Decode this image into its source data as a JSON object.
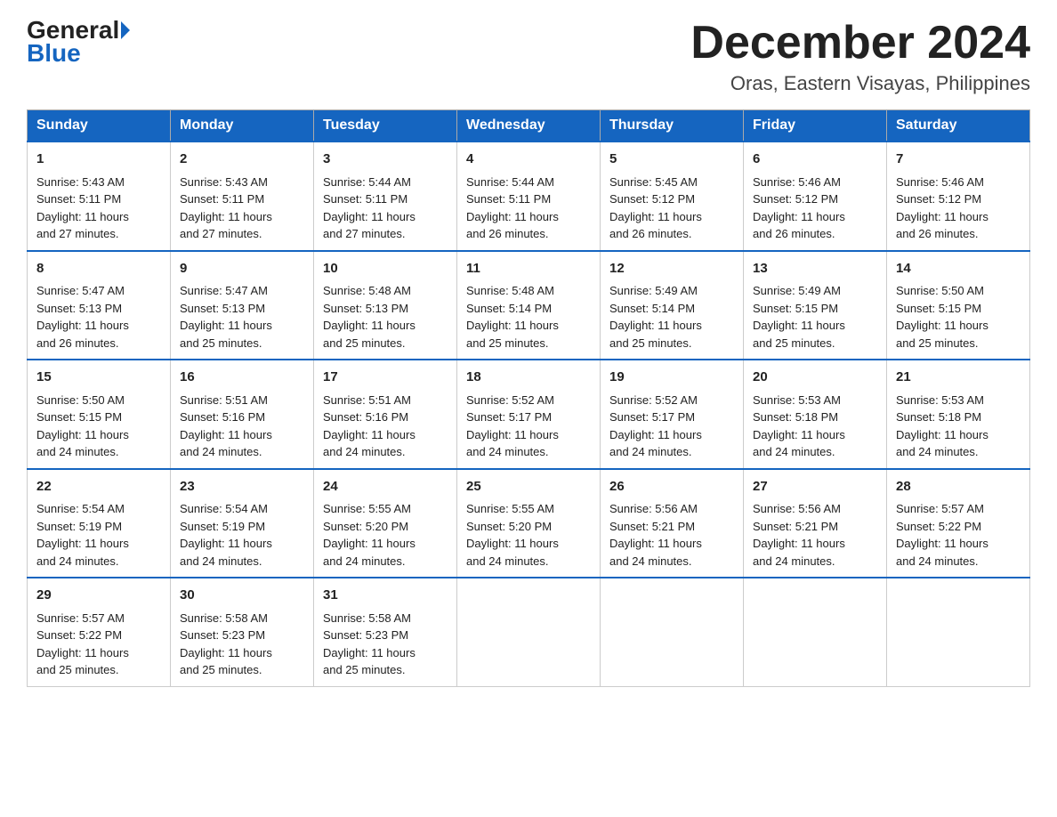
{
  "header": {
    "logo_general": "General",
    "logo_blue": "Blue",
    "month_title": "December 2024",
    "location": "Oras, Eastern Visayas, Philippines"
  },
  "weekdays": [
    "Sunday",
    "Monday",
    "Tuesday",
    "Wednesday",
    "Thursday",
    "Friday",
    "Saturday"
  ],
  "weeks": [
    [
      {
        "day": "1",
        "sunrise": "5:43 AM",
        "sunset": "5:11 PM",
        "daylight": "11 hours and 27 minutes."
      },
      {
        "day": "2",
        "sunrise": "5:43 AM",
        "sunset": "5:11 PM",
        "daylight": "11 hours and 27 minutes."
      },
      {
        "day": "3",
        "sunrise": "5:44 AM",
        "sunset": "5:11 PM",
        "daylight": "11 hours and 27 minutes."
      },
      {
        "day": "4",
        "sunrise": "5:44 AM",
        "sunset": "5:11 PM",
        "daylight": "11 hours and 26 minutes."
      },
      {
        "day": "5",
        "sunrise": "5:45 AM",
        "sunset": "5:12 PM",
        "daylight": "11 hours and 26 minutes."
      },
      {
        "day": "6",
        "sunrise": "5:46 AM",
        "sunset": "5:12 PM",
        "daylight": "11 hours and 26 minutes."
      },
      {
        "day": "7",
        "sunrise": "5:46 AM",
        "sunset": "5:12 PM",
        "daylight": "11 hours and 26 minutes."
      }
    ],
    [
      {
        "day": "8",
        "sunrise": "5:47 AM",
        "sunset": "5:13 PM",
        "daylight": "11 hours and 26 minutes."
      },
      {
        "day": "9",
        "sunrise": "5:47 AM",
        "sunset": "5:13 PM",
        "daylight": "11 hours and 25 minutes."
      },
      {
        "day": "10",
        "sunrise": "5:48 AM",
        "sunset": "5:13 PM",
        "daylight": "11 hours and 25 minutes."
      },
      {
        "day": "11",
        "sunrise": "5:48 AM",
        "sunset": "5:14 PM",
        "daylight": "11 hours and 25 minutes."
      },
      {
        "day": "12",
        "sunrise": "5:49 AM",
        "sunset": "5:14 PM",
        "daylight": "11 hours and 25 minutes."
      },
      {
        "day": "13",
        "sunrise": "5:49 AM",
        "sunset": "5:15 PM",
        "daylight": "11 hours and 25 minutes."
      },
      {
        "day": "14",
        "sunrise": "5:50 AM",
        "sunset": "5:15 PM",
        "daylight": "11 hours and 25 minutes."
      }
    ],
    [
      {
        "day": "15",
        "sunrise": "5:50 AM",
        "sunset": "5:15 PM",
        "daylight": "11 hours and 24 minutes."
      },
      {
        "day": "16",
        "sunrise": "5:51 AM",
        "sunset": "5:16 PM",
        "daylight": "11 hours and 24 minutes."
      },
      {
        "day": "17",
        "sunrise": "5:51 AM",
        "sunset": "5:16 PM",
        "daylight": "11 hours and 24 minutes."
      },
      {
        "day": "18",
        "sunrise": "5:52 AM",
        "sunset": "5:17 PM",
        "daylight": "11 hours and 24 minutes."
      },
      {
        "day": "19",
        "sunrise": "5:52 AM",
        "sunset": "5:17 PM",
        "daylight": "11 hours and 24 minutes."
      },
      {
        "day": "20",
        "sunrise": "5:53 AM",
        "sunset": "5:18 PM",
        "daylight": "11 hours and 24 minutes."
      },
      {
        "day": "21",
        "sunrise": "5:53 AM",
        "sunset": "5:18 PM",
        "daylight": "11 hours and 24 minutes."
      }
    ],
    [
      {
        "day": "22",
        "sunrise": "5:54 AM",
        "sunset": "5:19 PM",
        "daylight": "11 hours and 24 minutes."
      },
      {
        "day": "23",
        "sunrise": "5:54 AM",
        "sunset": "5:19 PM",
        "daylight": "11 hours and 24 minutes."
      },
      {
        "day": "24",
        "sunrise": "5:55 AM",
        "sunset": "5:20 PM",
        "daylight": "11 hours and 24 minutes."
      },
      {
        "day": "25",
        "sunrise": "5:55 AM",
        "sunset": "5:20 PM",
        "daylight": "11 hours and 24 minutes."
      },
      {
        "day": "26",
        "sunrise": "5:56 AM",
        "sunset": "5:21 PM",
        "daylight": "11 hours and 24 minutes."
      },
      {
        "day": "27",
        "sunrise": "5:56 AM",
        "sunset": "5:21 PM",
        "daylight": "11 hours and 24 minutes."
      },
      {
        "day": "28",
        "sunrise": "5:57 AM",
        "sunset": "5:22 PM",
        "daylight": "11 hours and 24 minutes."
      }
    ],
    [
      {
        "day": "29",
        "sunrise": "5:57 AM",
        "sunset": "5:22 PM",
        "daylight": "11 hours and 25 minutes."
      },
      {
        "day": "30",
        "sunrise": "5:58 AM",
        "sunset": "5:23 PM",
        "daylight": "11 hours and 25 minutes."
      },
      {
        "day": "31",
        "sunrise": "5:58 AM",
        "sunset": "5:23 PM",
        "daylight": "11 hours and 25 minutes."
      },
      null,
      null,
      null,
      null
    ]
  ],
  "labels": {
    "sunrise": "Sunrise:",
    "sunset": "Sunset:",
    "daylight": "Daylight:"
  }
}
